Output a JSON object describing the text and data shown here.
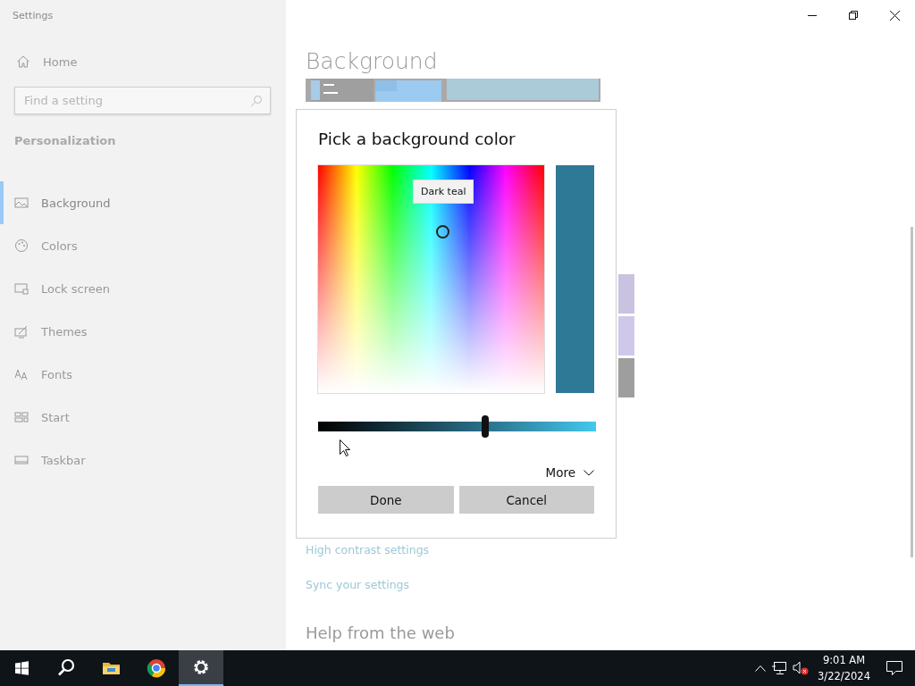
{
  "window": {
    "title": "Settings"
  },
  "sidebar": {
    "home": "Home",
    "search": {
      "placeholder": "Find a setting"
    },
    "section": "Personalization",
    "items": [
      {
        "label": "Background",
        "selected": true
      },
      {
        "label": "Colors",
        "selected": false
      },
      {
        "label": "Lock screen",
        "selected": false
      },
      {
        "label": "Themes",
        "selected": false
      },
      {
        "label": "Fonts",
        "selected": false
      },
      {
        "label": "Start",
        "selected": false
      },
      {
        "label": "Taskbar",
        "selected": false
      }
    ]
  },
  "main": {
    "title": "Background",
    "links": [
      "High contrast settings",
      "Sync your settings"
    ],
    "help_heading": "Help from the web"
  },
  "dialog": {
    "title": "Pick a background color",
    "tooltip": "Dark teal",
    "slider": {
      "level": 0.6
    },
    "more": "More",
    "buttons": [
      "Done",
      "Cancel"
    ]
  },
  "taskbar": {
    "apps": [
      {
        "selected": false
      },
      {
        "selected": false
      },
      {
        "selected": true
      }
    ],
    "time": "9:01 AM",
    "date": "3/22/2024"
  }
}
